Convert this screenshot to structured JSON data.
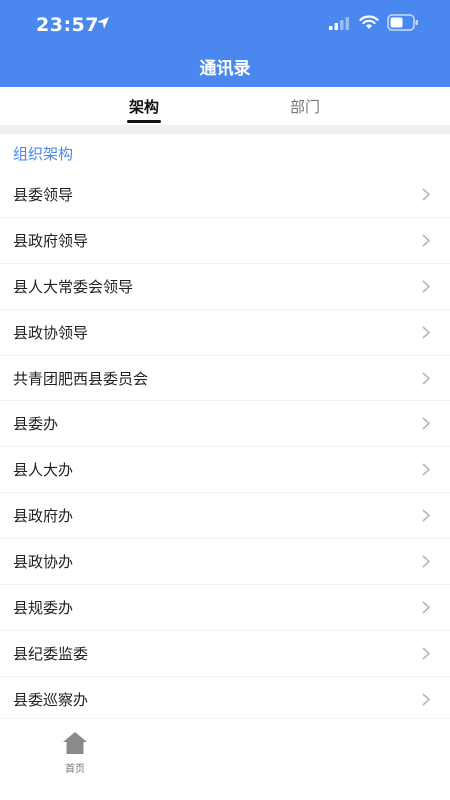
{
  "status_bar": {
    "time": "23:57"
  },
  "header": {
    "title": "通讯录"
  },
  "tabs": [
    {
      "label": "架构",
      "active": true
    },
    {
      "label": "部门",
      "active": false
    }
  ],
  "section": {
    "title": "组织架构"
  },
  "org_items": [
    "县委领导",
    "县政府领导",
    "县人大常委会领导",
    "县政协领导",
    "共青团肥西县委员会",
    "县委办",
    "县人大办",
    "县政府办",
    "县政协办",
    "县规委办",
    "县纪委监委",
    "县委巡察办"
  ],
  "tabbar": {
    "home_label": "首页"
  },
  "colors": {
    "brand": "#4a87ee",
    "active_tab_underline": "#111111"
  }
}
